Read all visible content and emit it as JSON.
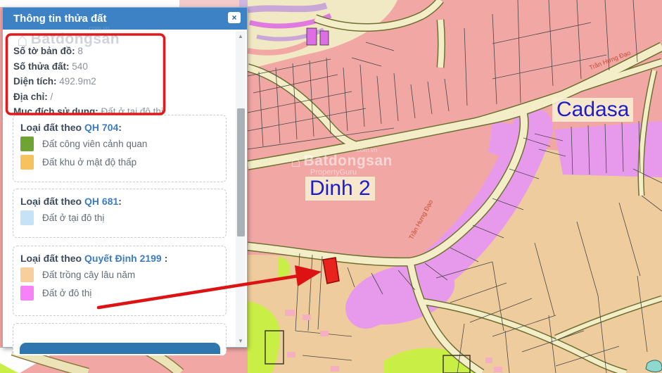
{
  "panel": {
    "title": "Thông tin thửa đất",
    "icons": {
      "close": "×",
      "scroll_up": "▲",
      "scroll_down": "▼",
      "house": "⌂"
    },
    "info": {
      "rows": [
        {
          "label": "Số tờ bản đồ:",
          "value": "8"
        },
        {
          "label": "Số thửa đất:",
          "value": "540"
        },
        {
          "label": "Diện tích:",
          "value": "492.9m2"
        },
        {
          "label": "Địa chỉ:",
          "value": "/"
        },
        {
          "label": "Mục đích sử dụng:",
          "value": "Đất ở tại đô thị"
        }
      ]
    },
    "sections": [
      {
        "prefix": "Loại đất theo",
        "link": "QH 704",
        "suffix": ":",
        "items": [
          {
            "color": "#6da434",
            "label": "Đất công viên cảnh quan"
          },
          {
            "color": "#f6c25e",
            "label": "Đất khu ở mật độ thấp"
          }
        ]
      },
      {
        "prefix": "Loại đất theo",
        "link": "QH 681",
        "suffix": ":",
        "items": [
          {
            "color": "#c5e2f6",
            "label": "Đất ở tại đô thị"
          }
        ]
      },
      {
        "prefix": "Loại đất theo",
        "link": "Quyết Định 2199",
        "suffix": " :",
        "items": [
          {
            "color": "#f8cf9c",
            "label": "Đất trồng cây lâu năm"
          },
          {
            "color": "#f782f7",
            "label": "Đất ở đô thị"
          }
        ]
      }
    ]
  },
  "map": {
    "labels": {
      "cadasa": "Cadasa",
      "dinh2": "Dinh 2",
      "road_top": "Trần Hưng Đạo",
      "road_side": "Trần Hưng Đạo"
    },
    "watermark_panel": {
      "brand": "Batdongsan",
      "domain": ".com.vn"
    },
    "watermark_map": {
      "brand": "Batdongsan",
      "domain": ".com.vn",
      "subtitle": "PropertyGuru"
    }
  },
  "colors": {
    "header_blue": "#3d82c4",
    "link_blue": "#3e7cc0",
    "button_blue": "#2e76ad",
    "annotation_red": "#e0191c",
    "parcel_salmon": "#f1a7a4",
    "parcel_tan": "#efcc9d",
    "parcel_magenta": "#e79aec",
    "parcel_chartreuse": "#c9ee45",
    "road_fill": "#f3eec8",
    "selected_parcel_red": "#e8231b"
  }
}
